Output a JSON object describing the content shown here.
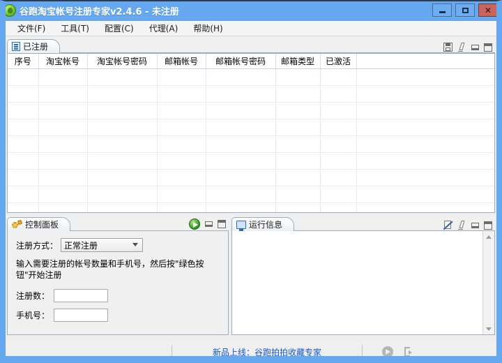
{
  "window": {
    "title": "谷跑淘宝帐号注册专家v2.4.6 - 未注册",
    "app_icon": "green-ball-icon",
    "minimize_label": "最小化",
    "maximize_label": "最大化",
    "close_label": "✕",
    "accent_blue": "#65a8f0",
    "close_red": "#c9645c"
  },
  "menubar": {
    "items": [
      {
        "label": "文件(F)",
        "name": "menu-file"
      },
      {
        "label": "工具(T)",
        "name": "menu-tools"
      },
      {
        "label": "配置(C)",
        "name": "menu-config"
      },
      {
        "label": "代理(A)",
        "name": "menu-proxy"
      },
      {
        "label": "帮助(H)",
        "name": "menu-help"
      }
    ]
  },
  "registered_panel": {
    "tab_label": "已注册",
    "tab_icon": "document-icon",
    "toolbar": {
      "save_icon": "save-icon",
      "edit_icon": "pencil-icon",
      "minimize_icon": "minimize-icon",
      "restore_icon": "restore-icon"
    },
    "columns": [
      "序号",
      "淘宝帐号",
      "淘宝帐号密码",
      "邮箱帐号",
      "邮箱帐号密码",
      "邮箱类型",
      "已激活"
    ],
    "rows": [],
    "empty_row_count": 10
  },
  "control_panel": {
    "tab_label": "控制面板",
    "tab_icon": "gears-icon",
    "start_button_icon": "green-play-icon",
    "minimize_icon": "minimize-icon",
    "restore_icon": "restore-icon",
    "mode_label": "注册方式：",
    "mode_value": "正常注册",
    "mode_options": [
      "正常注册"
    ],
    "hint": "输入需要注册的帐号数量和手机号，然后按\"绿色按钮\"开始注册",
    "count_label": "注册数：",
    "count_value": "",
    "phone_label": "手机号：",
    "phone_value": ""
  },
  "log_panel": {
    "tab_label": "运行信息",
    "tab_icon": "monitor-icon",
    "no_edit_icon": "no-edit-icon",
    "clear_icon": "eraser-icon",
    "minimize_icon": "minimize-icon",
    "restore_icon": "restore-icon",
    "content": "",
    "scroll_up_icon": "chevron-up-icon",
    "scroll_down_icon": "chevron-down-icon"
  },
  "statusbar": {
    "link_text": "新品上线：谷跑拍拍收藏专家",
    "link_color": "#1155cc",
    "play_icon": "gray-play-icon",
    "network_icon": "gray-network-icon"
  }
}
